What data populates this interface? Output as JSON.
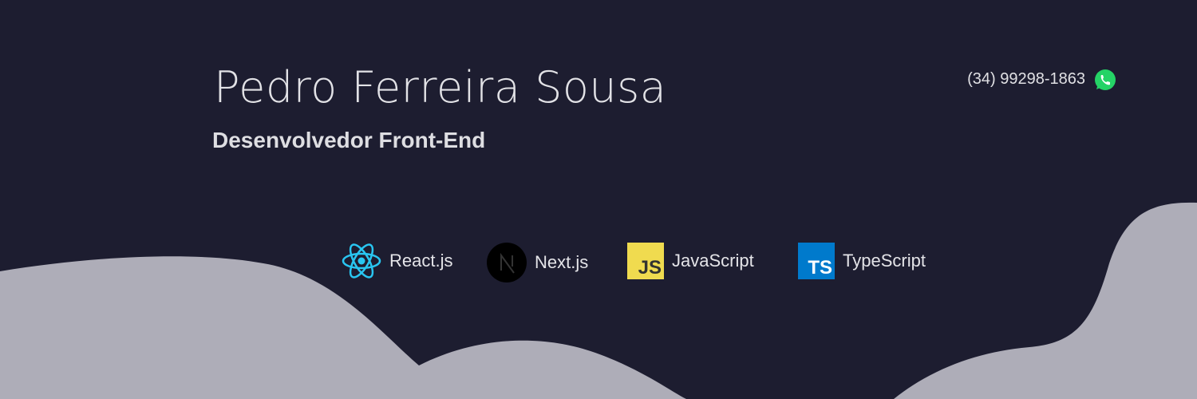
{
  "name": "Pedro Ferreira Sousa",
  "role": "Desenvolvedor Front-End",
  "contact": {
    "phone": "(34) 99298-1863",
    "icon": "whatsapp-icon"
  },
  "techs": [
    {
      "label": "React.js",
      "icon": "react-icon",
      "color": "#29c6f1"
    },
    {
      "label": "Next.js",
      "icon": "nextjs-icon",
      "color": "#000000"
    },
    {
      "label": "JavaScript",
      "icon": "javascript-icon",
      "color": "#f0db4f",
      "text": "JS"
    },
    {
      "label": "TypeScript",
      "icon": "typescript-icon",
      "color": "#007acc",
      "text": "TS"
    }
  ],
  "colors": {
    "background": "#1d1d30",
    "wave": "#aeadb8",
    "whatsapp": "#25d366"
  }
}
